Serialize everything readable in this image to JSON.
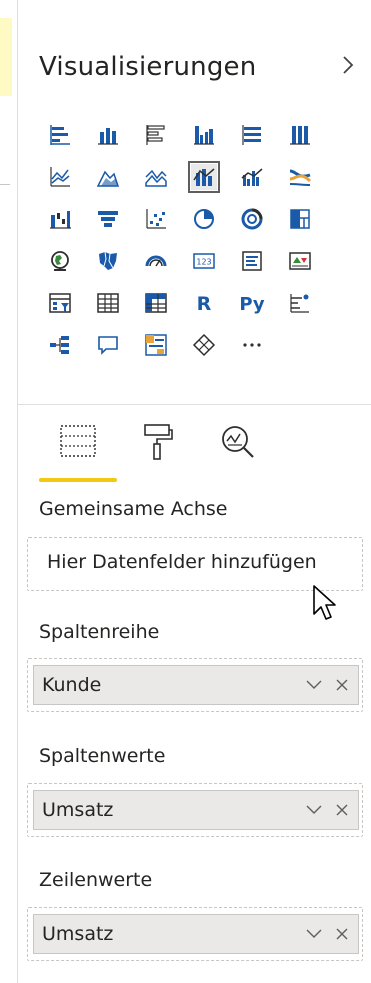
{
  "panel": {
    "title": "Visualisierungen",
    "expand_icon": "chevron-right-icon"
  },
  "visual_types": [
    [
      "stacked-bar-chart-icon",
      "stacked-column-chart-icon",
      "clustered-bar-chart-icon",
      "clustered-column-chart-icon",
      "100-stacked-bar-chart-icon",
      "100-stacked-column-chart-icon"
    ],
    [
      "line-chart-icon",
      "area-chart-icon",
      "stacked-area-chart-icon",
      "line-and-stacked-column-chart-icon",
      "line-and-clustered-column-chart-icon",
      "ribbon-chart-icon"
    ],
    [
      "waterfall-chart-icon",
      "funnel-chart-icon",
      "scatter-chart-icon",
      "pie-chart-icon",
      "donut-chart-icon",
      "treemap-icon"
    ],
    [
      "map-icon",
      "filled-map-icon",
      "gauge-icon",
      "card-icon",
      "multi-row-card-icon",
      "kpi-icon"
    ],
    [
      "slicer-icon",
      "table-icon",
      "matrix-icon",
      "r-visual-icon",
      "python-visual-icon",
      "key-influencers-icon"
    ],
    [
      "decomposition-tree-icon",
      "qa-icon",
      "smart-narrative-icon",
      "power-apps-icon",
      "more-visuals-icon"
    ]
  ],
  "selected_visual": "line-and-stacked-column-chart-icon",
  "tabs": [
    {
      "name": "fields-tab",
      "icon": "fields-icon",
      "active": true
    },
    {
      "name": "format-tab",
      "icon": "paint-roller-icon",
      "active": false
    },
    {
      "name": "analytics-tab",
      "icon": "analytics-icon",
      "active": false
    }
  ],
  "wells": {
    "shared_axis": {
      "label": "Gemeinsame Achse",
      "placeholder": "Hier Datenfelder hinzufügen"
    },
    "column_series": {
      "label": "Spaltenreihe",
      "value": "Kunde"
    },
    "column_values": {
      "label": "Spaltenwerte",
      "value": "Umsatz"
    },
    "line_values": {
      "label": "Zeilenwerte",
      "value": "Umsatz"
    }
  },
  "colors": {
    "accent_yellow": "#f2c811",
    "icon_blue": "#1a5aa8",
    "icon_dark": "#2f2f2f",
    "icon_orange": "#e8a33b",
    "pill_bg": "#ebe9e7",
    "border_dashed": "#c8c6c4"
  }
}
